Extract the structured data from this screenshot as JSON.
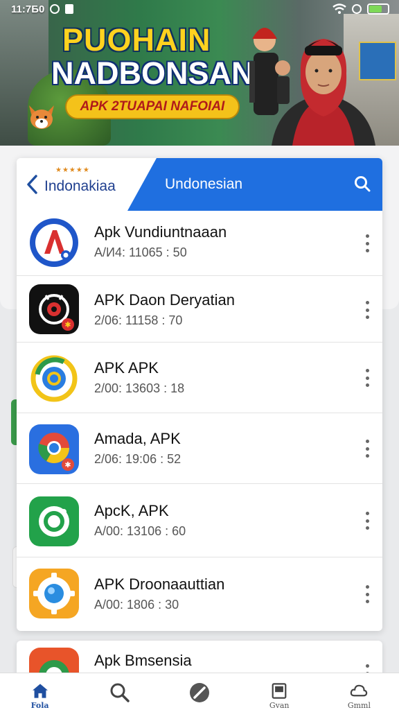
{
  "status_bar": {
    "time": "11:7Б0",
    "battery_level": 0.7
  },
  "banner": {
    "title_line1": "PUOHAIN",
    "title_line2": "NADBONSAN",
    "pill_text": "APK 2TUAPAI NAFOIAI"
  },
  "header": {
    "left_label": "Indonakiaa",
    "stars": "★★★★★",
    "right_label": "Undonesian",
    "accent_color": "#1f6fe0"
  },
  "apps": [
    {
      "name": "Apk Vundiuntnaaan",
      "meta": "A/И4: 11065 : 50",
      "icon": "letter-a-app-icon"
    },
    {
      "name": "APK Daon Deryatian",
      "meta": "2/06: 11158 : 70",
      "icon": "clock-app-icon"
    },
    {
      "name": "APK APK",
      "meta": "2/00: 13603 : 18",
      "icon": "colorful-ring-app-icon"
    },
    {
      "name": "Amada, APK",
      "meta": "2/06: 19:06 : 52",
      "icon": "chrome-like-app-icon"
    },
    {
      "name": "ApcK, APK",
      "meta": "A/00: 13106 : 60",
      "icon": "green-ring-app-icon"
    },
    {
      "name": "APK Droonaauttian",
      "meta": "A/00: 1806 : 30",
      "icon": "gear-app-icon"
    }
  ],
  "partial_app": {
    "name": "Apk Bmsensia",
    "icon": "browser-app-icon"
  },
  "nav": [
    {
      "label": "Fola",
      "icon": "home-icon"
    },
    {
      "label": "",
      "icon": "search-icon"
    },
    {
      "label": "",
      "icon": "compass-icon"
    },
    {
      "label": "Gvan",
      "icon": "window-icon"
    },
    {
      "label": "Gmml",
      "icon": "cloud-icon"
    }
  ]
}
